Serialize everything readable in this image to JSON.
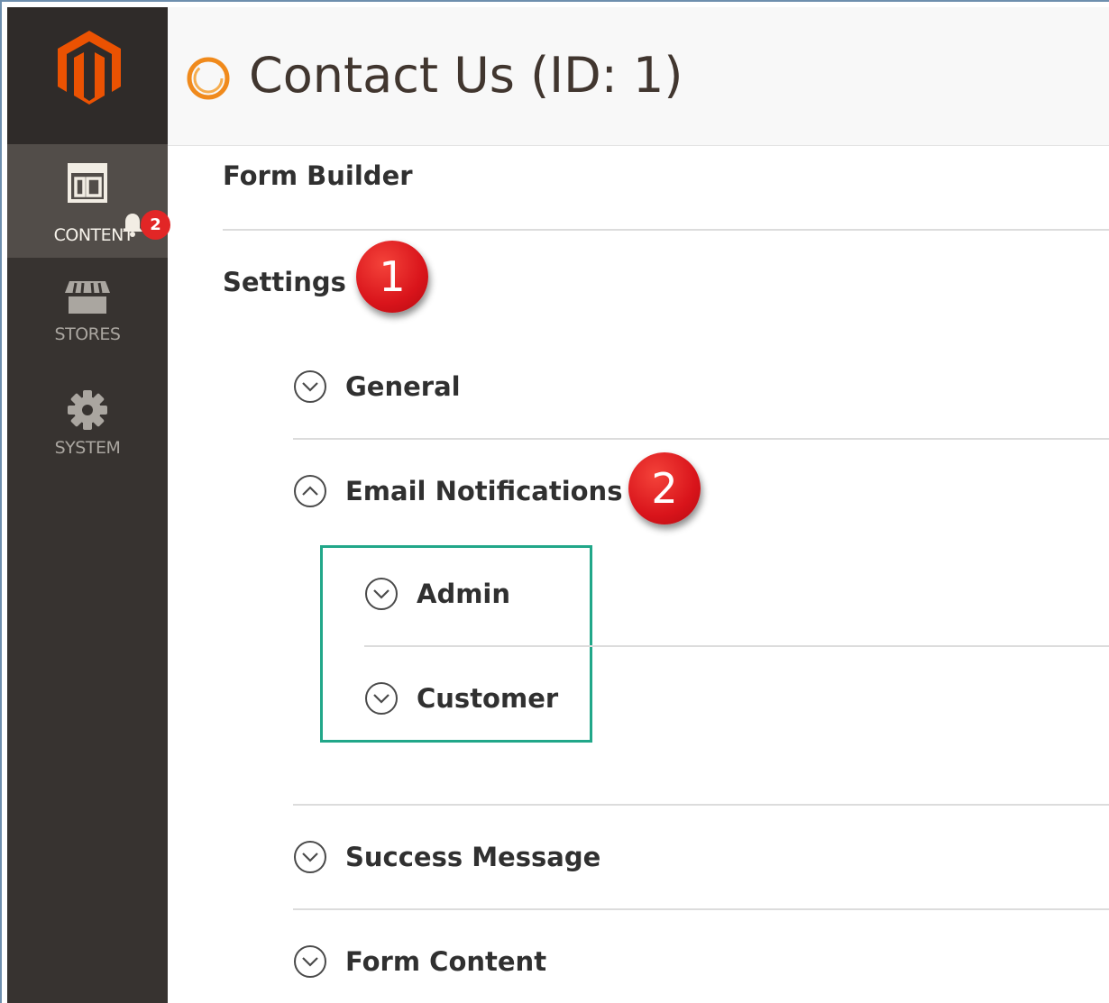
{
  "sidebar": {
    "items": [
      {
        "label": "CONTENT",
        "badge": "2"
      },
      {
        "label": "STORES"
      },
      {
        "label": "SYSTEM"
      }
    ]
  },
  "header": {
    "title": "Contact Us (ID: 1)"
  },
  "main": {
    "form_builder": "Form Builder",
    "settings": "Settings",
    "sections": [
      {
        "label": "General"
      },
      {
        "label": "Email Notifications"
      },
      {
        "label": "Admin"
      },
      {
        "label": "Customer"
      },
      {
        "label": "Success Message"
      },
      {
        "label": "Form Content"
      }
    ]
  },
  "callouts": [
    "1",
    "2"
  ],
  "colors": {
    "sidebar_bg": "#373330",
    "sidebar_active": "#524d49",
    "magento_orange": "#eb5202",
    "highlight_green": "#21a789",
    "callout_red": "#d9141b"
  }
}
